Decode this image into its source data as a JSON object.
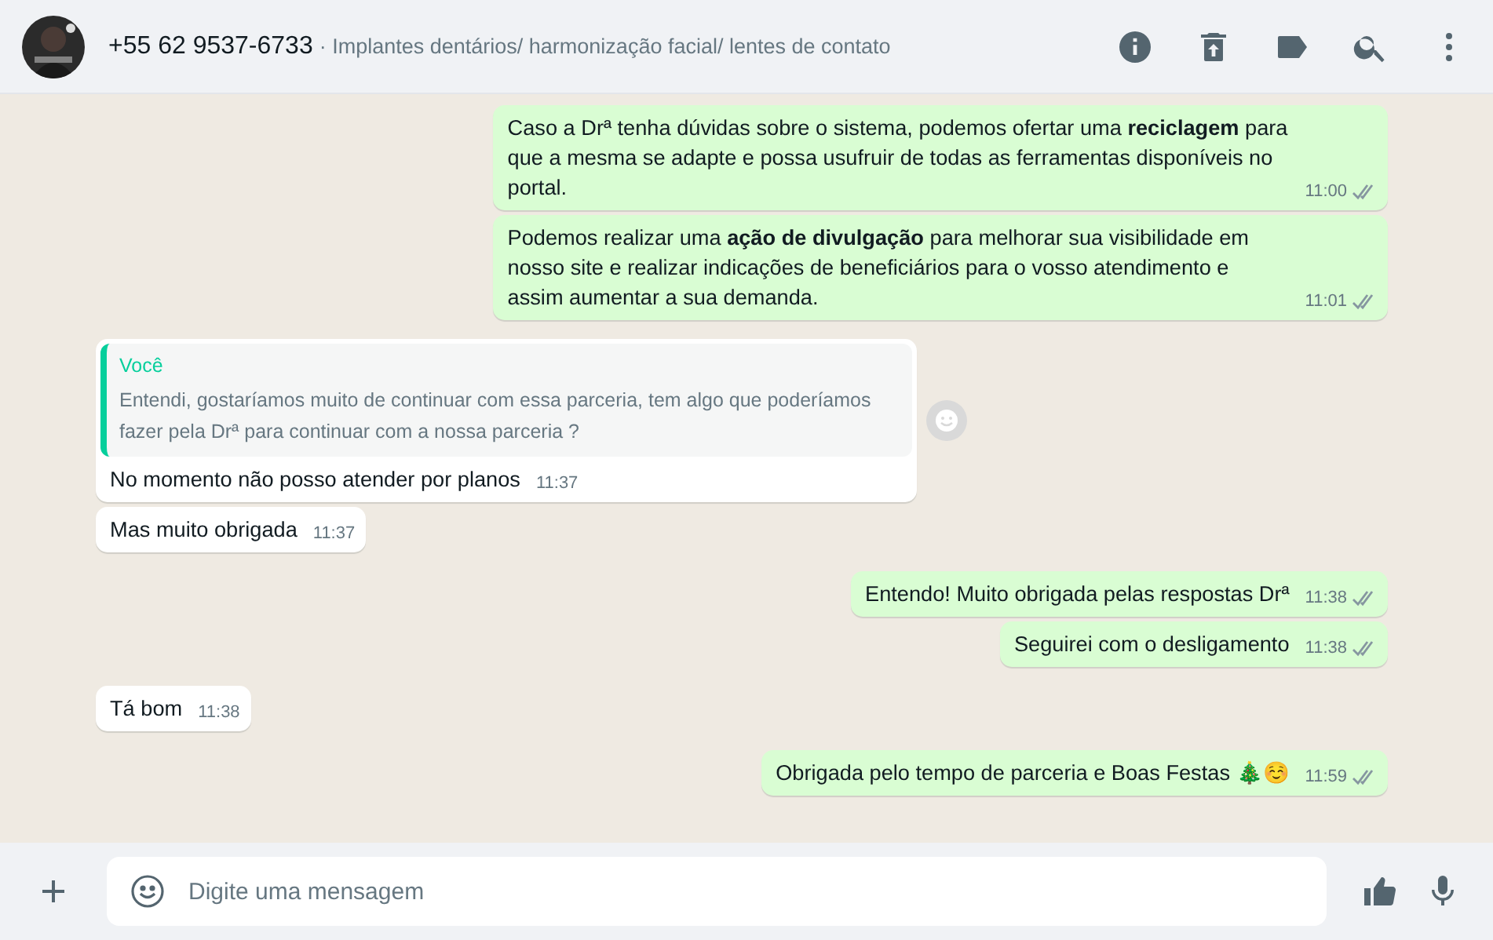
{
  "header": {
    "title": "+55 62 9537-6733",
    "subtitle": "· Implantes dentários/ harmonização facial/ lentes de contato"
  },
  "messages": [
    {
      "kind": "out",
      "text": "Caso a Drª tenha dúvidas sobre o sistema, podemos ofertar uma **reciclagem** para que a mesma se adapte e possa usufruir de todas as ferramentas disponíveis no portal.",
      "time": "11:00",
      "read": false
    },
    {
      "kind": "out",
      "text": "Podemos realizar uma **ação de divulgação** para melhorar sua visibilidade em nosso site e realizar indicações de beneficiários para o vosso atendimento e assim aumentar a sua demanda.",
      "time": "11:01",
      "read": false
    },
    {
      "kind": "in",
      "quote": {
        "author": "Você",
        "text": "Entendi, gostaríamos muito de continuar com essa parceria, tem algo que poderíamos fazer pela Drª para continuar com a nossa parceria ?"
      },
      "text": "No momento não posso atender por planos",
      "time": "11:37"
    },
    {
      "kind": "in",
      "text": "Mas muito obrigada",
      "time": "11:37"
    },
    {
      "kind": "out",
      "text": "Entendo! Muito obrigada pelas respostas Drª",
      "time": "11:38",
      "read": false
    },
    {
      "kind": "out",
      "text": "Seguirei com o desligamento",
      "time": "11:38",
      "read": false
    },
    {
      "kind": "in",
      "text": "Tá bom",
      "time": "11:38"
    },
    {
      "kind": "out",
      "text": "Obrigada pelo tempo de parceria e Boas Festas 🎄☺️",
      "time": "11:59",
      "read": false
    }
  ],
  "composer": {
    "placeholder": "Digite uma mensagem"
  }
}
